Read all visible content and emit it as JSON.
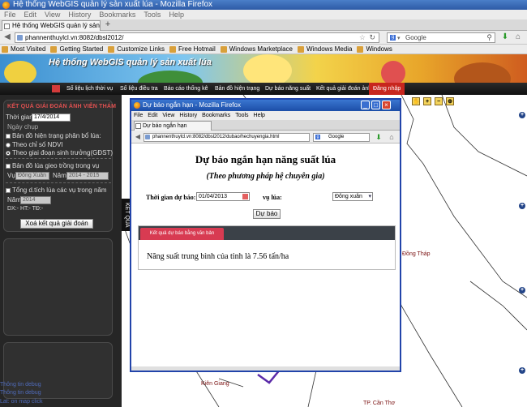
{
  "main_window": {
    "title": "Hệ thống WebGIS quản lý sản xuất lúa - Mozilla Firefox",
    "menu": [
      "File",
      "Edit",
      "View",
      "History",
      "Bookmarks",
      "Tools",
      "Help"
    ],
    "tab_label": "Hệ thống WebGIS quản lý sản xuất lúa",
    "url": "phannenthuylcl.vn:8082/dbsl2012/",
    "search_placeholder": "Google",
    "search_engine_glyph": "g",
    "bookmarks": [
      "Most Visited",
      "Getting Started",
      "Customize Links",
      "Free Hotmail",
      "Windows Marketplace",
      "Windows Media",
      "Windows"
    ]
  },
  "site": {
    "banner_title": "Hệ thống WebGIS quản lý sản xuất lúa",
    "nav": [
      "Số liệu lịch thời vụ",
      "Số liệu điều tra",
      "Báo cáo thống kê",
      "Bản đồ hiện trạng",
      "Dự báo năng suất",
      "Kết quả giải đoán ảnh",
      "Đăng nhập"
    ]
  },
  "left_panel": {
    "header": "KẾT QUẢ GIẢI ĐOÁN ẢNH VIỄN THÁM",
    "date_label": "Thời gian",
    "date_value": "17/4/2014",
    "date_sub": "Ngày chụp",
    "chk_current_map": "Bản đồ hiện trạng phân bổ lúa:",
    "radio_ndvi": "Theo chỉ số NDVI",
    "radio_stage": "Theo giai đoạn sinh trưởng(GĐST)",
    "chk_sowing_map": "Bản đồ lúa gieo trồng trong vụ",
    "crop_label": "Vụ",
    "crop_value": "Đông Xuân",
    "year_label": "Năm",
    "year_value": "2014 - 2015",
    "chk_total_area": "Tổng d.tích lúa các vụ trong năm",
    "year2_label": "Năm",
    "year2_value": "2014",
    "stats_line": "DX:-   HT:-   TĐ:-",
    "clear_button": "Xoá kết quả giải đoán"
  },
  "side_tab": "KẾT QUẢ",
  "debug": [
    "Thông tin debug",
    "Thông tin debug",
    "Lat: on map click"
  ],
  "map": {
    "labels": [
      "Đồng Tháp",
      "Kiên Giang",
      "TP. Cần Thơ"
    ]
  },
  "popup": {
    "title": "Dự báo ngắn hạn - Mozilla Firefox",
    "menu": [
      "File",
      "Edit",
      "View",
      "History",
      "Bookmarks",
      "Tools",
      "Help"
    ],
    "tab_label": "Dự báo ngắn hạn",
    "url": "phannenthuylcl.vn:8082/dbsl2012/dubao/hechuyengia.html",
    "search_placeholder": "Google",
    "search_engine_glyph": "g",
    "heading": "Dự báo ngắn hạn năng suất lúa",
    "subheading": "(Theo phương pháp hệ chuyên gia)",
    "time_label": "Thời gian dự báo:",
    "time_value": "01/04/2013",
    "crop_label": "vụ lúa:",
    "crop_value": "Đông xuân",
    "forecast_button": "Dự báo",
    "result_tab": "Kết quả dự báo bằng văn bản",
    "result_text": "Năng suất trung bình của tỉnh là 7.56 tấn/ha"
  },
  "colors": {
    "nav_active": "#c8261e",
    "result_tab": "#d83b52",
    "panel_bg": "#262626",
    "popup_border": "#2244aa"
  }
}
